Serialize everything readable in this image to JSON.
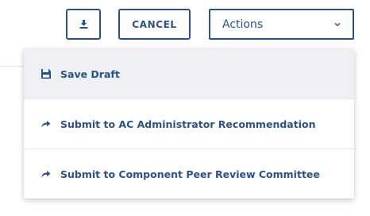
{
  "toolbar": {
    "download_icon": "download-icon",
    "cancel_label": "CANCEL",
    "actions_label": "Actions",
    "actions_chevron_icon": "chevron-down-icon"
  },
  "menu": {
    "items": [
      {
        "label": "Save Draft",
        "icon": "save-icon",
        "highlighted": true
      },
      {
        "label": "Submit to AC Administrator Recommendation",
        "icon": "forward-arrow-icon",
        "highlighted": false
      },
      {
        "label": "Submit to Component Peer Review Committee",
        "icon": "forward-arrow-icon",
        "highlighted": false
      }
    ]
  },
  "colors": {
    "accent": "#2c5285",
    "menu_highlight": "#eef0f3",
    "divider": "#e4e6ea"
  }
}
